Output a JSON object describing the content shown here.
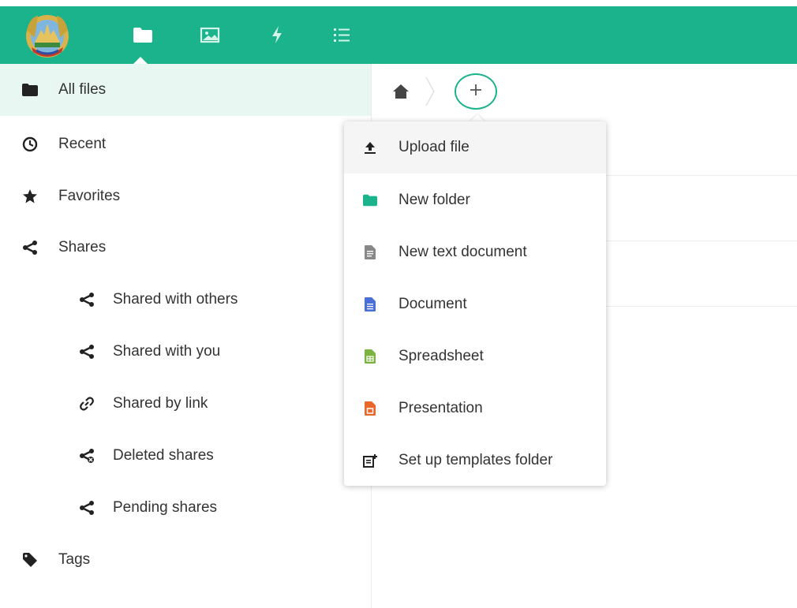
{
  "header": {
    "logo_name": "laos-emblem-logo",
    "apps": [
      {
        "name": "files-app-icon",
        "icon": "folder-icon",
        "active": true
      },
      {
        "name": "photos-app-icon",
        "icon": "image-icon"
      },
      {
        "name": "activity-app-icon",
        "icon": "lightning-icon"
      },
      {
        "name": "tasks-app-icon",
        "icon": "list-icon"
      }
    ],
    "accent_color": "#1ab38c"
  },
  "sidebar": {
    "items": [
      {
        "label": "All files",
        "icon": "folder-icon",
        "active": true
      },
      {
        "label": "Recent",
        "icon": "clock-icon"
      },
      {
        "label": "Favorites",
        "icon": "star-icon"
      },
      {
        "label": "Shares",
        "icon": "share-icon"
      },
      {
        "label": "Shared with others",
        "icon": "share-icon"
      },
      {
        "label": "Shared with you",
        "icon": "share-icon"
      },
      {
        "label": "Shared by link",
        "icon": "link-icon"
      },
      {
        "label": "Deleted shares",
        "icon": "share-deleted-icon"
      },
      {
        "label": "Pending shares",
        "icon": "share-icon"
      },
      {
        "label": "Tags",
        "icon": "tag-icon"
      }
    ]
  },
  "breadcrumb": {
    "home_icon": "home-icon",
    "new_button_icon": "plus-icon"
  },
  "new_menu": {
    "items": [
      {
        "label": "Upload file",
        "icon": "upload-icon"
      },
      {
        "label": "New folder",
        "icon": "folder-icon",
        "color": "#1ab38c"
      },
      {
        "label": "New text document",
        "icon": "text-document-icon",
        "color": "#888888"
      },
      {
        "label": "Document",
        "icon": "document-icon",
        "color": "#4a6fd6"
      },
      {
        "label": "Spreadsheet",
        "icon": "spreadsheet-icon",
        "color": "#7cb342"
      },
      {
        "label": "Presentation",
        "icon": "presentation-icon",
        "color": "#e8672a"
      },
      {
        "label": "Set up templates folder",
        "icon": "template-folder-icon"
      }
    ]
  }
}
